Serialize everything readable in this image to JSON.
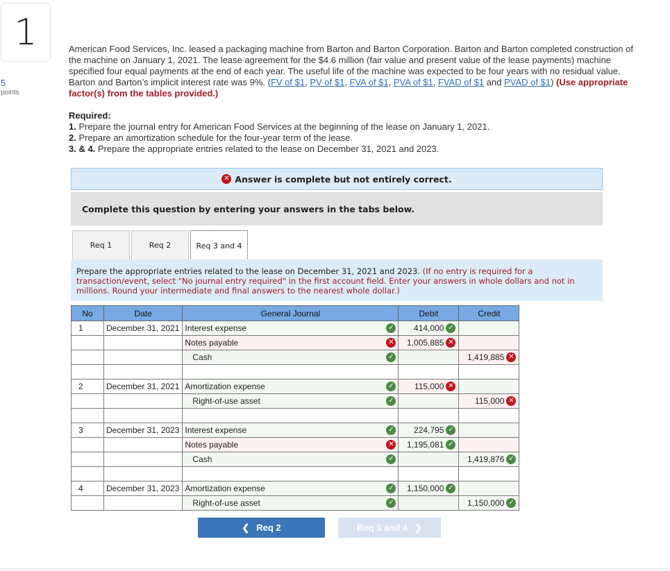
{
  "question": {
    "number": "1",
    "points_value": "5",
    "points_label": "points"
  },
  "problem": {
    "text": "American Food Services, Inc. leased a packaging machine from Barton and Barton Corporation. Barton and Barton completed construction of the machine on January 1, 2021. The lease agreement for the $4.6 million (fair value and present value of the lease payments) machine specified four equal payments at the end of each year. The useful life of the machine was expected to be four years with no residual value. Barton and Barton’s implicit interest rate was 9%. (",
    "links": [
      "FV of $1",
      "PV of $1",
      "FVA of $1",
      "PVA of $1",
      "FVAD of $1",
      "PVAD of $1"
    ],
    "and_word": " and ",
    "close_paren": ") ",
    "instruction": "(Use appropriate factor(s) from the tables provided.)"
  },
  "required": {
    "heading": "Required:",
    "items": [
      {
        "num": "1.",
        "text": " Prepare the journal entry for American Food Services at the beginning of the lease on January 1, 2021."
      },
      {
        "num": "2.",
        "text": " Prepare an amortization schedule for the four-year term of the lease."
      },
      {
        "num": "3. & 4.",
        "text": " Prepare the appropriate entries related to the lease on December 31, 2021 and 2023."
      }
    ]
  },
  "banner": {
    "text": "Answer is complete but not entirely correct.",
    "icon": "x-circle-icon"
  },
  "complete_text": "Complete this question by entering your answers in the tabs below.",
  "tabs": [
    {
      "label": "Req 1",
      "active": false
    },
    {
      "label": "Req 2",
      "active": false
    },
    {
      "label": "Req 3 and 4",
      "active": true
    }
  ],
  "instructions": {
    "main": "Prepare the appropriate entries related to the lease on December 31, 2021 and 2023. ",
    "note": "(If no entry is required for a transaction/event, select \"No journal entry required\" in the first account field. Enter your answers in whole dollars and not in millions. Round your intermediate and final answers to the nearest whole dollar.)"
  },
  "journal": {
    "headers": {
      "no": "No",
      "date": "Date",
      "general_journal": "General Journal",
      "debit": "Debit",
      "credit": "Credit"
    },
    "rows": [
      {
        "no": "1",
        "date": "December 31, 2021",
        "account": "Interest expense",
        "indent": false,
        "account_status": "correct",
        "debit": "414,000",
        "debit_status": "correct",
        "credit": "",
        "credit_status": ""
      },
      {
        "no": "",
        "date": "",
        "account": "Notes payable",
        "indent": false,
        "account_status": "incorrect",
        "debit": "1,005,885",
        "debit_status": "incorrect",
        "credit": "",
        "credit_status": ""
      },
      {
        "no": "",
        "date": "",
        "account": "Cash",
        "indent": true,
        "account_status": "correct",
        "debit": "",
        "debit_status": "",
        "credit": "1,419,885",
        "credit_status": "incorrect"
      },
      {
        "no": "",
        "date": "",
        "account": "",
        "indent": false,
        "account_status": "",
        "debit": "",
        "debit_status": "",
        "credit": "",
        "credit_status": ""
      },
      {
        "no": "2",
        "date": "December 31, 2021",
        "account": "Amortization expense",
        "indent": false,
        "account_status": "correct",
        "debit": "115,000",
        "debit_status": "incorrect",
        "credit": "",
        "credit_status": ""
      },
      {
        "no": "",
        "date": "",
        "account": "Right-of-use asset",
        "indent": true,
        "account_status": "correct",
        "debit": "",
        "debit_status": "",
        "credit": "115,000",
        "credit_status": "incorrect"
      },
      {
        "no": "",
        "date": "",
        "account": "",
        "indent": false,
        "account_status": "",
        "debit": "",
        "debit_status": "",
        "credit": "",
        "credit_status": ""
      },
      {
        "no": "3",
        "date": "December 31, 2023",
        "account": "Interest expense",
        "indent": false,
        "account_status": "correct",
        "debit": "224,795",
        "debit_status": "correct",
        "credit": "",
        "credit_status": ""
      },
      {
        "no": "",
        "date": "",
        "account": "Notes payable",
        "indent": false,
        "account_status": "incorrect",
        "debit": "1,195,081",
        "debit_status": "correct",
        "credit": "",
        "credit_status": ""
      },
      {
        "no": "",
        "date": "",
        "account": "Cash",
        "indent": true,
        "account_status": "correct",
        "debit": "",
        "debit_status": "",
        "credit": "1,419,876",
        "credit_status": "correct"
      },
      {
        "no": "",
        "date": "",
        "account": "",
        "indent": false,
        "account_status": "",
        "debit": "",
        "debit_status": "",
        "credit": "",
        "credit_status": ""
      },
      {
        "no": "4",
        "date": "December 31, 2023",
        "account": "Amortization expense",
        "indent": false,
        "account_status": "correct",
        "debit": "1,150,000",
        "debit_status": "correct",
        "credit": "",
        "credit_status": ""
      },
      {
        "no": "",
        "date": "",
        "account": "Right-of-use asset",
        "indent": true,
        "account_status": "correct",
        "debit": "",
        "debit_status": "",
        "credit": "1,150,000",
        "credit_status": "correct"
      }
    ]
  },
  "nav": {
    "prev_label": "Req 2",
    "next_label": "Req 3 and 4",
    "prev_icon": "chevron-left-icon",
    "next_icon": "chevron-right-icon"
  },
  "colors": {
    "correct": "#4a8a44",
    "incorrect": "#c0161d",
    "header_blue": "#78a9e2",
    "button_blue": "#3a76b8"
  }
}
